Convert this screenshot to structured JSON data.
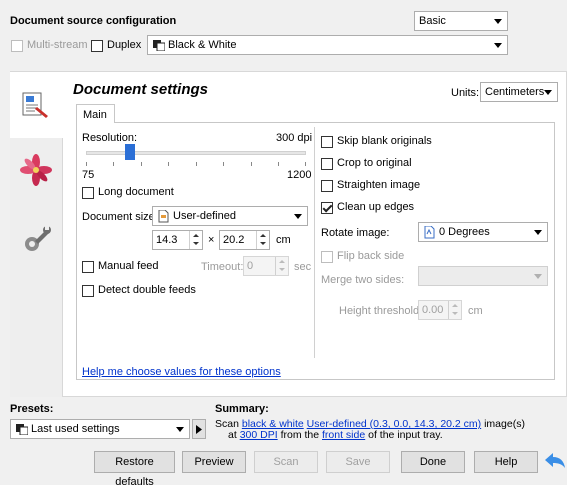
{
  "header": {
    "title": "Document source configuration",
    "mode_select": "Basic",
    "multistream_label": "Multi-stream",
    "duplex_label": "Duplex",
    "color_select": "Black & White"
  },
  "settings": {
    "title": "Document settings",
    "units_label": "Units:",
    "units_value": "Centimeters",
    "tab_main": "Main",
    "resolution_label": "Resolution:",
    "resolution_value": "300 dpi",
    "resolution_min": "75",
    "resolution_max": "1200",
    "resolution_fraction": 0.2,
    "long_document_label": "Long document",
    "doc_size_label": "Document size:",
    "doc_size_value": "User-defined",
    "width_value": "14.3",
    "times_sign": "×",
    "height_value": "20.2",
    "size_unit": "cm",
    "manual_feed_label": "Manual feed",
    "timeout_label": "Timeout:",
    "timeout_value": "0",
    "timeout_unit": "sec",
    "detect_double_label": "Detect double feeds",
    "skip_blank_label": "Skip blank originals",
    "crop_label": "Crop to original",
    "straighten_label": "Straighten image",
    "clean_edges_label": "Clean up edges",
    "rotate_label": "Rotate image:",
    "rotate_value": "0 Degrees",
    "flip_label": "Flip back side",
    "merge_label": "Merge two sides:",
    "height_threshold_label": "Height threshold:",
    "height_threshold_value": "0.00",
    "height_threshold_unit": "cm",
    "help_link": "Help me choose values for these options"
  },
  "presets": {
    "label": "Presets:",
    "value": "Last used settings"
  },
  "summary": {
    "label": "Summary:",
    "scan_word": "Scan",
    "color_link": "black & white",
    "size_link": "User-defined (0.3, 0.0, 14.3, 20.2 cm)",
    "image_word": "image(s)",
    "at_word": "at",
    "dpi_link": "300 DPI",
    "from_word": "from the",
    "side_link": "front side",
    "tail": "of the input tray."
  },
  "buttons": {
    "restore": "Restore defaults",
    "preview": "Preview",
    "scan": "Scan",
    "save": "Save",
    "done": "Done",
    "help": "Help"
  },
  "colors": {
    "accent_blue": "#2b6fd6",
    "link": "#0033cc",
    "back_arrow": "#3a8ee6"
  },
  "icons": {
    "document_settings": "document-settings-icon",
    "image_settings": "flower-icon",
    "advanced_settings": "wrench-icon",
    "color_mode": "color-mode-icon",
    "page_size": "page-icon",
    "rotate": "rotate-page-icon",
    "presets": "preset-icon",
    "back": "back-arrow-icon"
  }
}
